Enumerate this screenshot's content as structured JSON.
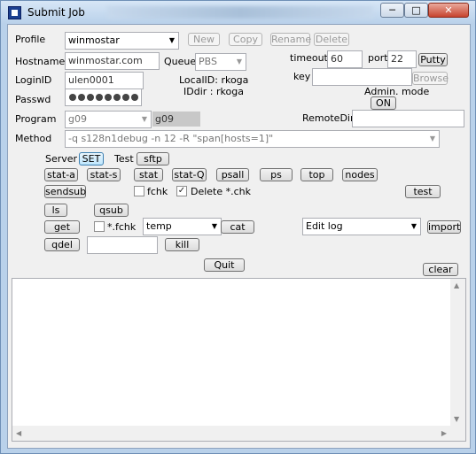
{
  "window": {
    "title": "Submit Job"
  },
  "titlebar_buttons": {
    "minimize": "─",
    "maximize": "□",
    "close": "✕"
  },
  "profile": {
    "label": "Profile",
    "value": "winmostar",
    "new_label": "New",
    "copy_label": "Copy",
    "rename_label": "Rename",
    "delete_label": "Delete"
  },
  "host": {
    "hostname_label": "Hostname",
    "hostname_value": "winmostar.com",
    "queue_label": "Queue",
    "queue_value": "PBS",
    "timeout_label": "timeout",
    "timeout_value": "60",
    "port_label": "port",
    "port_value": "22",
    "putty_label": "Putty"
  },
  "login": {
    "loginid_label": "LoginID",
    "loginid_value": "ulen0001",
    "localid_label": "LocalID:",
    "localid_value": "rkoga",
    "iddir_label": "IDdir :",
    "iddir_value": "rkoga",
    "key_label": "key",
    "browse_label": "Browse",
    "passwd_label": "Passwd",
    "admin_label": "Admin. mode",
    "admin_value": "ON"
  },
  "program": {
    "label": "Program",
    "value": "g09",
    "shaded_value": "g09",
    "remotedir_label": "RemoteDir",
    "remotedir_value": ""
  },
  "method": {
    "label": "Method",
    "value": "-q s128n1debug -n 12 -R \"span[hosts=1]\""
  },
  "server": {
    "server_label": "Server",
    "set_label": "SET",
    "test_label": "Test",
    "sftp_label": "sftp"
  },
  "commands": {
    "stat_a": "stat-a",
    "stat_s": "stat-s",
    "stat": "stat",
    "stat_q": "stat-Q",
    "psall": "psall",
    "ps": "ps",
    "top": "top",
    "nodes": "nodes",
    "sendsub": "sendsub",
    "fchk_label": "fchk",
    "delete_chk_label": "Delete *.chk",
    "test": "test",
    "ls": "ls",
    "qsub": "qsub",
    "get": "get",
    "star_fchk_label": "*.fchk",
    "temp_value": "temp",
    "cat": "cat",
    "editlog_value": "Edit log",
    "import": "import",
    "qdel": "qdel",
    "kill_input_value": "",
    "kill": "kill",
    "quit": "Quit",
    "clear": "clear"
  },
  "log": {
    "content": ""
  }
}
